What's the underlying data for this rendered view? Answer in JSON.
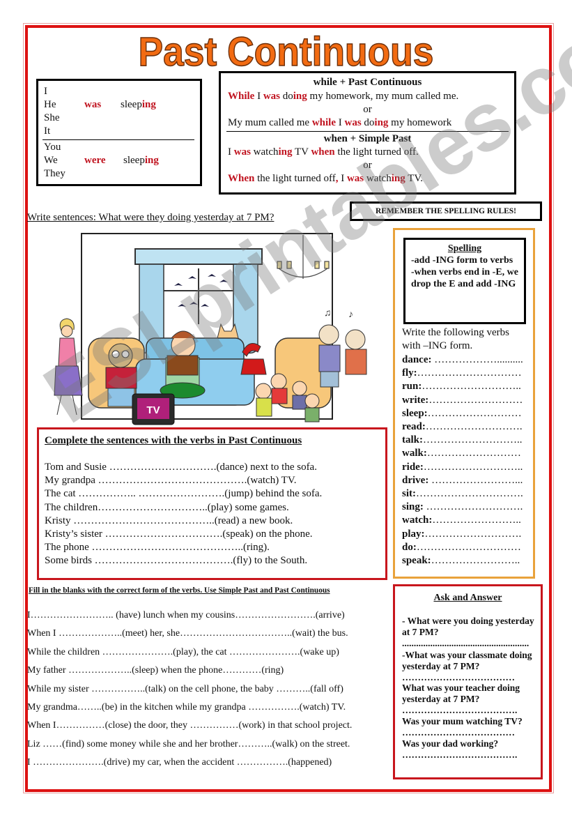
{
  "title": "Past Continuous",
  "pronoun_table": {
    "singular": [
      "I",
      "He",
      "She",
      "It"
    ],
    "singular_aux": "was",
    "plural": [
      "You",
      "We",
      "They"
    ],
    "plural_aux": "were",
    "verb_stem": "sleep",
    "verb_suffix": "ing"
  },
  "while_when_box": {
    "while_header": "while + Past Continuous",
    "while_ex1": [
      "While",
      " I ",
      "was",
      " do",
      "ing",
      " my homework, my mum called me."
    ],
    "or1": "or",
    "while_ex2": [
      "My mum called me ",
      "while",
      " I ",
      "was",
      " do",
      "ing",
      " my homework"
    ],
    "when_header": "when + Simple Past",
    "when_ex1": [
      "I ",
      "was",
      " watch",
      "ing",
      " TV ",
      "when",
      " the light turned off."
    ],
    "or2": "or",
    "when_ex2": [
      "When",
      " the light turned off",
      ",",
      " I ",
      "was",
      " watch",
      "ing",
      " TV."
    ]
  },
  "write_sentences_heading": "Write sentences: What were they doing yesterday at 7 PM?",
  "remember_banner": "REMEMBER THE SPELLING RULES!",
  "spelling_box": {
    "title": "Spelling",
    "rule1": "-add -ING form to verbs",
    "rule2": "-when verbs end in -E, we drop the E and add -ING"
  },
  "verbs_intro": "Write the following verbs with –ING form.",
  "verbs": [
    {
      "verb": "dance:",
      "blank": " ……………….........."
    },
    {
      "verb": "fly:",
      "blank": "…………………………"
    },
    {
      "verb": "run:",
      "blank": "……………………….."
    },
    {
      "verb": "write:",
      "blank": "………………………"
    },
    {
      "verb": "sleep:",
      "blank": "………………………"
    },
    {
      "verb": "read:",
      "blank": "………………………."
    },
    {
      "verb": "talk:",
      "blank": "……………………….."
    },
    {
      "verb": "walk:",
      "blank": "………………………"
    },
    {
      "verb": "ride:",
      "blank": "……………………….."
    },
    {
      "verb": "drive:",
      "blank": " ……………………..."
    },
    {
      "verb": "sit:",
      "blank": "…………………………."
    },
    {
      "verb": "sing:",
      "blank": " ………………………."
    },
    {
      "verb": "watch:",
      "blank": "…………………….."
    },
    {
      "verb": "play:",
      "blank": "………………………."
    },
    {
      "verb": "do:",
      "blank": "…………………………"
    },
    {
      "verb": "speak:",
      "blank": "…………………….."
    }
  ],
  "illustration": {
    "description": "Living room scene: woman on phone, grandpa in armchair, child reading on sofa, TV, cat behind sofa, ringing phone, children playing, two kids dancing, birds flying outside window, chandelier",
    "tv_label": "TV"
  },
  "complete_section": {
    "heading": "Complete the sentences with the verbs in Past Continuous",
    "sentences": [
      "Tom and Susie ………………………….(dance) next to the sofa.",
      "My grandpa …………………………………….(watch) TV.",
      "The cat …………….. …………………….(jump) behind the sofa.",
      "The children…………………………..(play) some games.",
      "Kristy …………………………………..(read) a new book.",
      "Kristy’s sister …………………………….(speak) on the phone.",
      "The phone ……………………………………..(ring).",
      "Some birds ………………………………….(fly) to the South."
    ]
  },
  "fill_section": {
    "heading": "Fill in the blanks with the correct form of the verbs. Use Simple Past and Past Continuous",
    "sentences": [
      "I…………………….. (have) lunch when my cousins…………………….(arrive)",
      "When I ………………..(meet) her, she……………………………..(wait) the bus.",
      "While the children ………………….(play), the cat ………………….(wake up)",
      "My father ………………..(sleep) when the phone…………(ring)",
      "While my sister ……………..(talk) on the cell phone, the baby ………..(fall off)",
      "My grandma……..(be) in the kitchen while my grandpa …………….(watch) TV.",
      "When I……………(close) the door, they ……………(work) in that school project.",
      "Liz ……(find) some money while she and her brother………..(walk) on the street.",
      "I ………………….(drive) my car, when the accident …………….(happened)"
    ]
  },
  "ask_answer": {
    "heading": "Ask and Answer",
    "questions": [
      {
        "q": "- What were you doing yesterday at 7 PM?",
        "blank": "......................................................"
      },
      {
        "q": "-What was your classmate doing yesterday at 7 PM?",
        "blank": "………………………………"
      },
      {
        "q": "What was your teacher doing yesterday at 7 PM?",
        "blank": "………………………………."
      },
      {
        "q": "Was your mum watching TV?",
        "blank": "………………………………"
      },
      {
        "q": "Was your dad working?",
        "blank": "………………………………."
      }
    ]
  },
  "watermark": "ESLprintables.com",
  "colors": {
    "frame_red": "#dd1111",
    "title_orange": "#f26b12",
    "highlight_red": "#c0131f",
    "box_orange": "#e9a23b",
    "box_red": "#c8161d"
  }
}
